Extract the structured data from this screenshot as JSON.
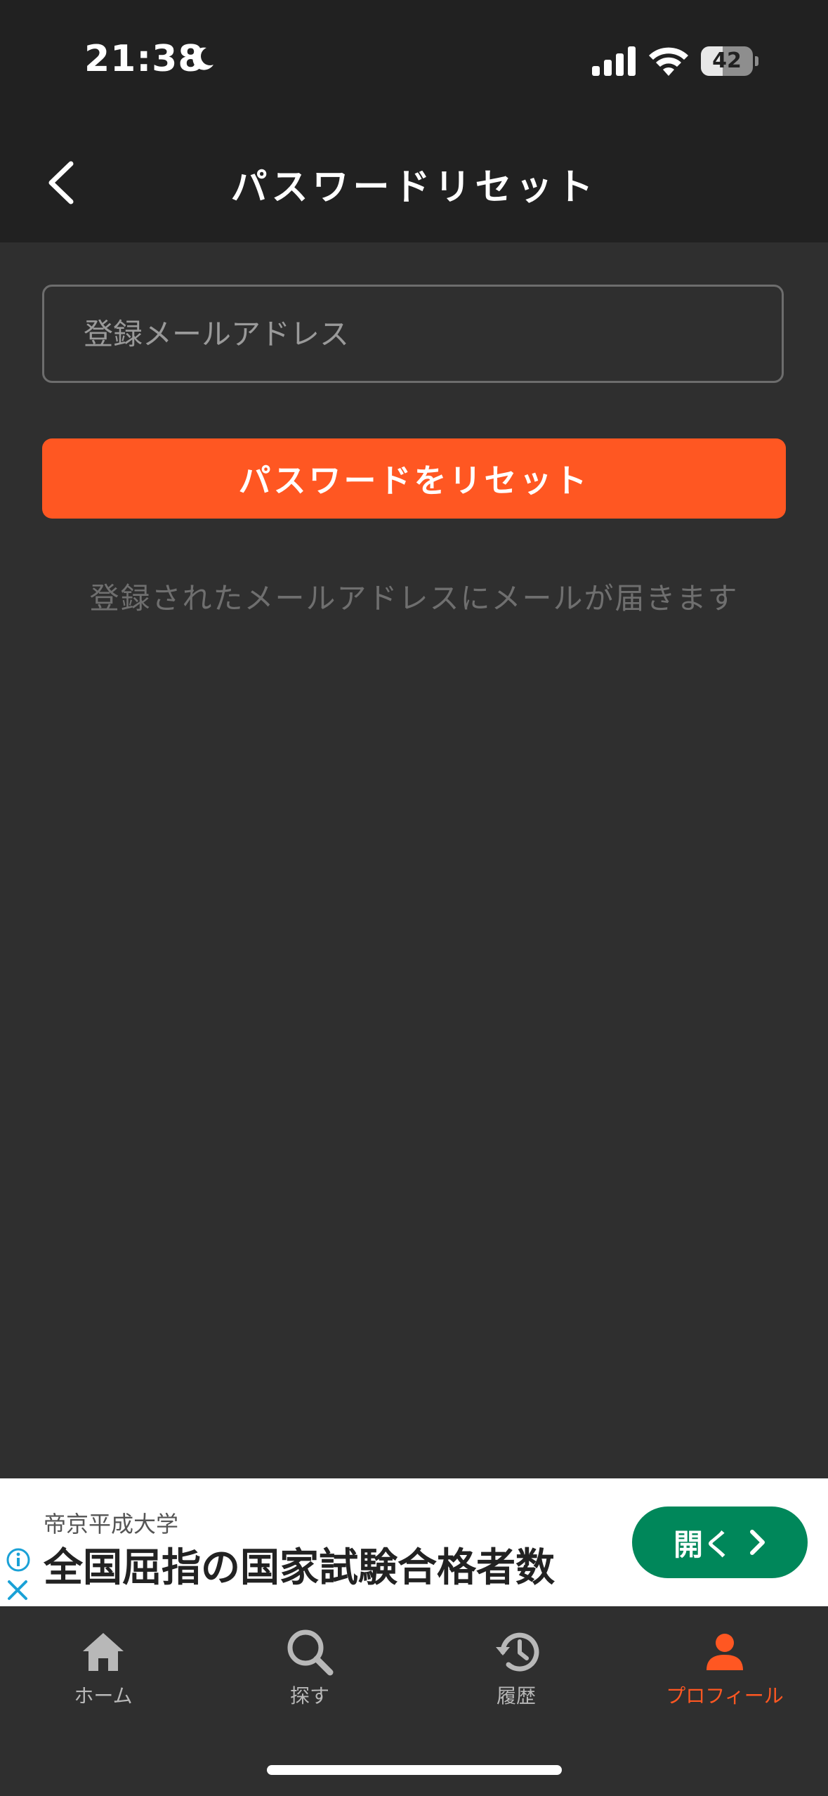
{
  "status_bar": {
    "time": "21:38",
    "battery": "42",
    "battery_level": 0.42
  },
  "header": {
    "title": "パスワードリセット"
  },
  "form": {
    "email_placeholder": "登録メールアドレス",
    "email_value": "",
    "submit_label": "パスワードをリセット",
    "hint": "登録されたメールアドレスにメールが届きます"
  },
  "ad": {
    "advertiser": "帝京平成大学",
    "headline": "全国屈指の国家試験合格者数",
    "cta_label": "開く"
  },
  "tabbar": {
    "items": [
      {
        "label": "ホーム",
        "icon": "home-icon",
        "active": false
      },
      {
        "label": "探す",
        "icon": "search-icon",
        "active": false
      },
      {
        "label": "履歴",
        "icon": "history-icon",
        "active": false
      },
      {
        "label": "プロフィール",
        "icon": "profile-icon",
        "active": true
      }
    ]
  },
  "colors": {
    "accent": "#ff5722",
    "background": "#2f2f2f",
    "header": "#212121",
    "ad_cta": "#00875a"
  }
}
